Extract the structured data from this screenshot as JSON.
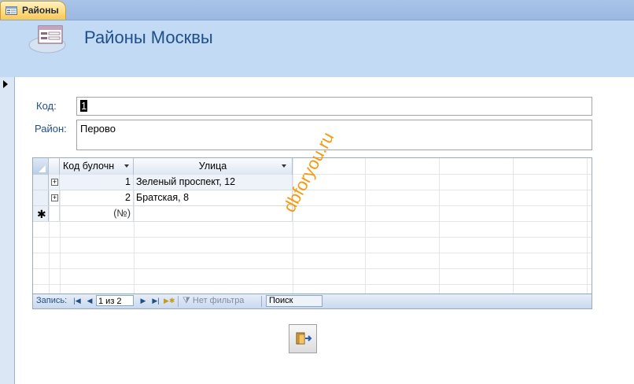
{
  "tab": {
    "label": "Районы",
    "icon": "form-icon"
  },
  "header": {
    "title": "Районы Москвы",
    "icon": "form-header-icon"
  },
  "form": {
    "code_label": "Код:",
    "code_value": "1",
    "district_label": "Район:",
    "district_value": "Перово"
  },
  "subform": {
    "columns": [
      "Код булочн",
      "Улица"
    ],
    "rows": [
      {
        "code": "1",
        "street": "Зеленый проспект, 12"
      },
      {
        "code": "2",
        "street": "Братская, 8"
      }
    ],
    "new_row": {
      "code": "(№)"
    }
  },
  "navigation": {
    "record_label": "Запись:",
    "counter": "1 из 2",
    "no_filter": "Нет фильтра",
    "search": "Поиск"
  },
  "watermark": "dbforyou.ru",
  "exit_button": {
    "icon": "exit-door-icon"
  }
}
